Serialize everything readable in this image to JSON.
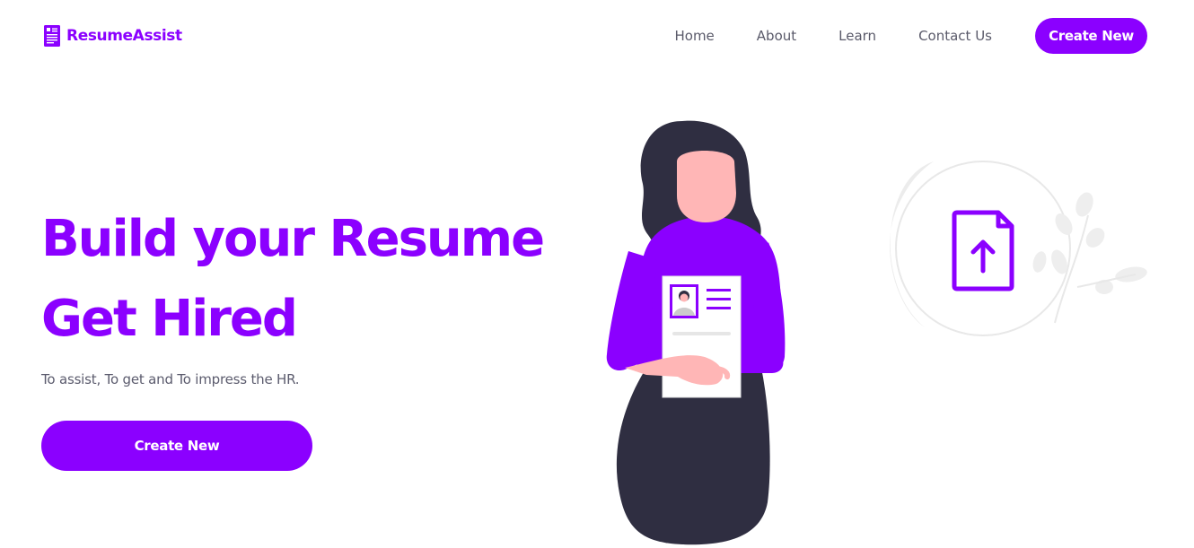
{
  "brand": {
    "name": "ResumeAssist",
    "icon": "resume-document-icon",
    "color": "#8b00ff"
  },
  "nav": {
    "links": [
      "Home",
      "About",
      "Learn",
      "Contact Us"
    ],
    "cta_label": "Create New"
  },
  "hero": {
    "headline_line1": "Build your Resume",
    "headline_line2": "Get Hired",
    "subtitle": "To assist, To get and To impress the HR.",
    "cta_label": "Create New"
  },
  "illustration": {
    "upload_icon": "file-upload-icon",
    "figure": "woman-holding-resume",
    "colors": {
      "accent": "#8b00ff",
      "hair": "#2f2e41",
      "skin": "#ffb6b6",
      "skirt": "#2f2e41",
      "paper": "#ffffff",
      "decor": "#e6e6e6"
    }
  }
}
